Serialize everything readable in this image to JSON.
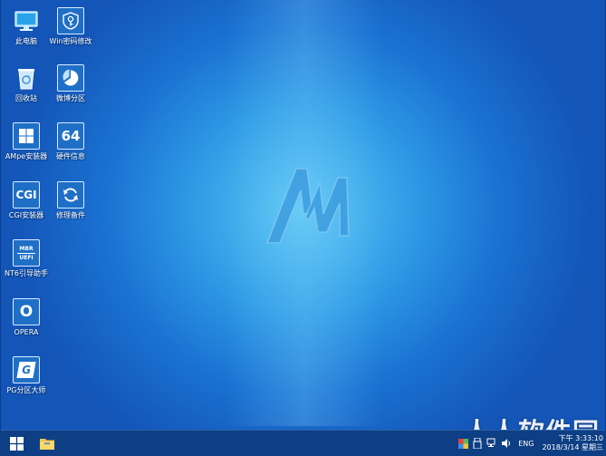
{
  "desktop": {
    "icons": [
      {
        "label": "此电脑"
      },
      {
        "label": "Win密码修改"
      },
      {
        "label": "回收站"
      },
      {
        "label": "微博分区"
      },
      {
        "label": "AMpe安装器"
      },
      {
        "label": "硬件信息"
      },
      {
        "label": "CGI安装器"
      },
      {
        "label": "修理备件"
      },
      {
        "label": "NT6引导助手"
      },
      {
        "label": "OPERA"
      },
      {
        "label": "PG分区大师"
      }
    ],
    "tile_text": {
      "hw": "64",
      "cgi": "CGI",
      "mbr": "MBR",
      "uefi": "UEFI",
      "opera": "O",
      "pg": "G"
    }
  },
  "wallpaper": {
    "logo_text": "AM"
  },
  "taskbar": {
    "language": "ENG",
    "clock_time": "下午 3:33:10",
    "clock_date": "2018/3/14 星期三"
  },
  "watermark": {
    "text": "人人软件园"
  },
  "colors": {
    "taskbar": "#0e3f84",
    "tile": "#1f6fc6",
    "wallpaper_center": "#5cc6f4",
    "wallpaper_edge": "#1455b8"
  }
}
